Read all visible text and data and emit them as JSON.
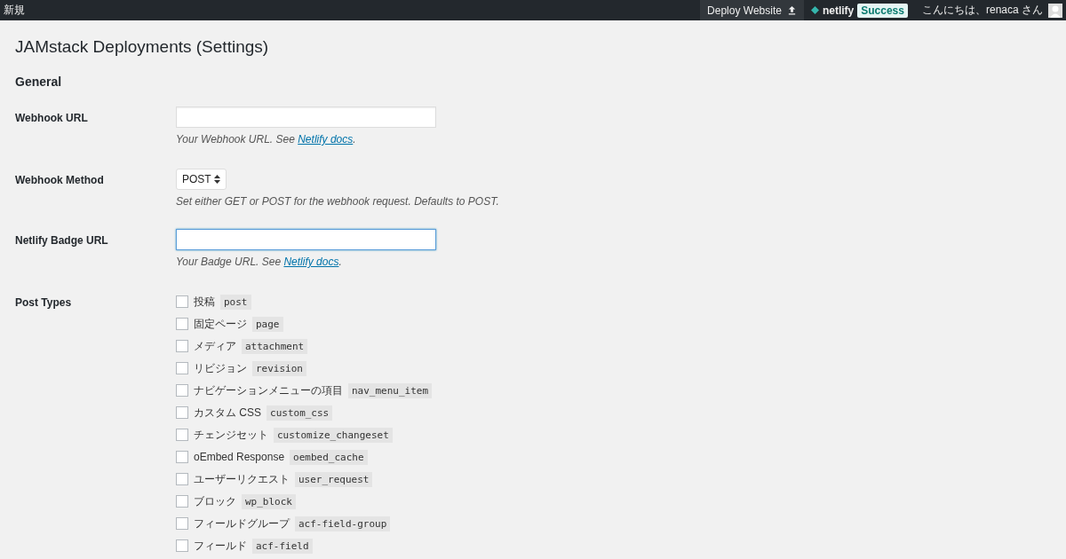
{
  "admin_bar": {
    "new_label": "新規",
    "deploy_button": "Deploy Website",
    "netlify_logo": "netlify",
    "deploy_status": "Success",
    "greeting": "こんにちは、renaca さん"
  },
  "page_title": "JAMstack Deployments (Settings)",
  "section_title": "General",
  "fields": [
    {
      "kind": "text",
      "label": "Webhook URL",
      "focused": false,
      "help": "Your Webhook URL. See ",
      "help_link": "Netlify docs",
      "help_end": "."
    },
    {
      "kind": "select",
      "label": "Webhook Method",
      "value": "POST",
      "help": "Set either GET or POST for the webhook request. Defaults to POST."
    },
    {
      "kind": "text",
      "label": "Netlify Badge URL",
      "focused": true,
      "help": "Your Badge URL. See ",
      "help_link": "Netlify docs",
      "help_end": "."
    }
  ],
  "post_types": {
    "label": "Post Types",
    "items": [
      {
        "label": "投稿",
        "slug": "post",
        "checked": false
      },
      {
        "label": "固定ページ",
        "slug": "page",
        "checked": false
      },
      {
        "label": "メディア",
        "slug": "attachment",
        "checked": false
      },
      {
        "label": "リビジョン",
        "slug": "revision",
        "checked": false
      },
      {
        "label": "ナビゲーションメニューの項目",
        "slug": "nav_menu_item",
        "checked": false
      },
      {
        "label": "カスタム CSS",
        "slug": "custom_css",
        "checked": false
      },
      {
        "label": "チェンジセット",
        "slug": "customize_changeset",
        "checked": false
      },
      {
        "label": "oEmbed Response",
        "slug": "oembed_cache",
        "checked": false
      },
      {
        "label": "ユーザーリクエスト",
        "slug": "user_request",
        "checked": false
      },
      {
        "label": "ブロック",
        "slug": "wp_block",
        "checked": false
      },
      {
        "label": "フィールドグループ",
        "slug": "acf-field-group",
        "checked": false
      },
      {
        "label": "フィールド",
        "slug": "acf-field",
        "checked": false
      }
    ]
  }
}
